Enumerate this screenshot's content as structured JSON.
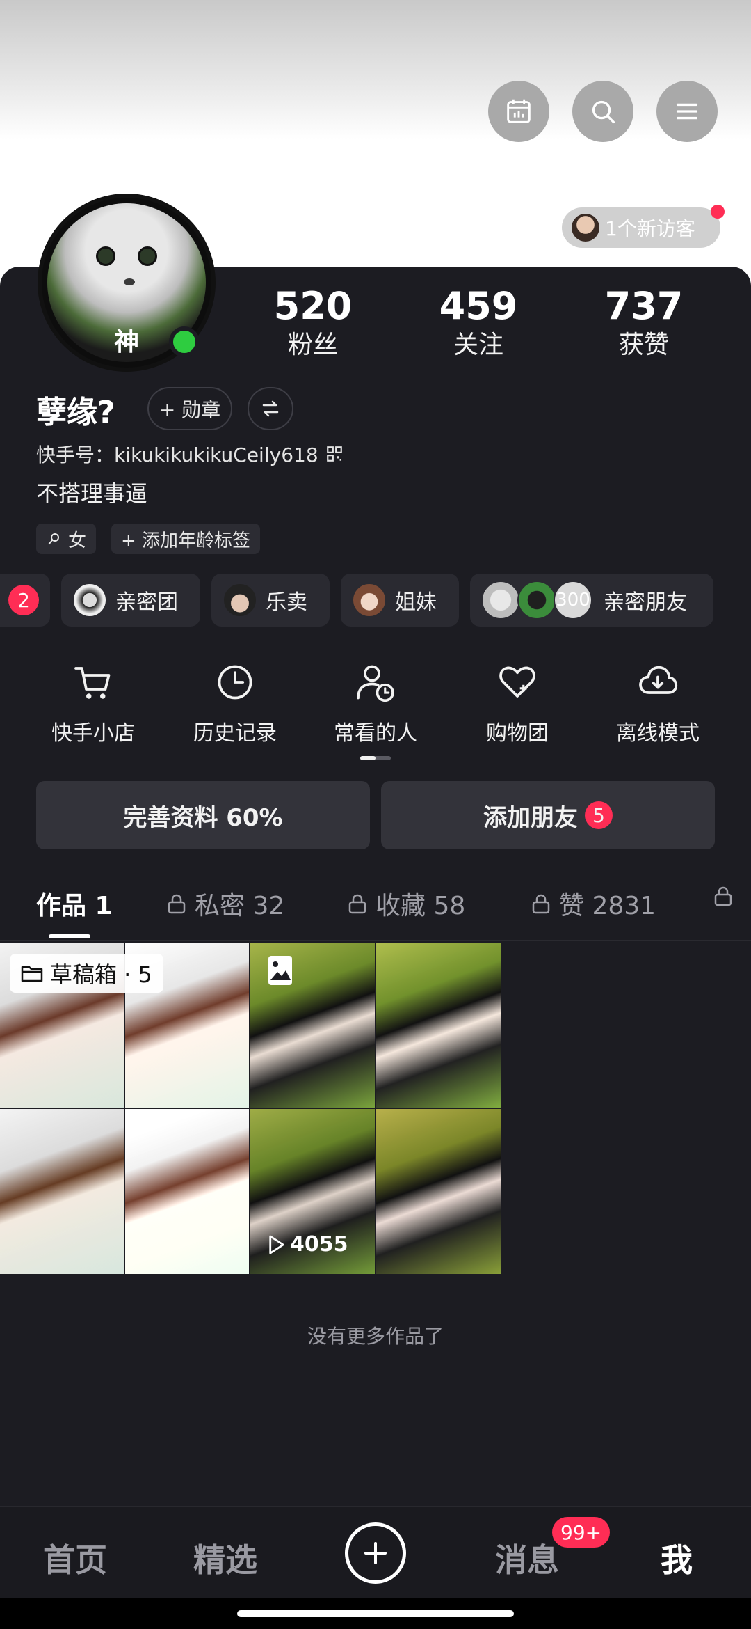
{
  "header": {
    "visitor_text": "1个新访客",
    "icons": [
      "calendar-icon",
      "search-icon",
      "menu-icon"
    ]
  },
  "profile": {
    "avatar_label": "神",
    "username": "孽缘?",
    "medal_button": "+ 勋章",
    "kuaishou_id": "快手号：kikukikukikuCeily618",
    "bio": "不搭理事逼",
    "tags": [
      "女",
      "+ 添加年龄标签"
    ]
  },
  "stats": [
    {
      "value": "520",
      "label": "粉丝"
    },
    {
      "value": "459",
      "label": "关注"
    },
    {
      "value": "737",
      "label": "获赞"
    }
  ],
  "groups": {
    "first_badge": "2",
    "items": [
      {
        "label": "亲密团"
      },
      {
        "label": "乐卖"
      },
      {
        "label": "姐妹"
      },
      {
        "count": "300",
        "label": "亲密朋友"
      }
    ]
  },
  "quick_actions": [
    {
      "label": "快手小店",
      "icon": "cart-icon"
    },
    {
      "label": "历史记录",
      "icon": "clock-icon"
    },
    {
      "label": "常看的人",
      "icon": "person-clock-icon"
    },
    {
      "label": "购物团",
      "icon": "heart-icon"
    },
    {
      "label": "离线模式",
      "icon": "cloud-download-icon"
    }
  ],
  "actions": {
    "complete_profile": "完善资料 60%",
    "add_friends": "添加朋友",
    "add_friends_badge": "5"
  },
  "tabs": [
    {
      "label": "作品 1",
      "active": true
    },
    {
      "label": "私密 32"
    },
    {
      "label": "收藏 58"
    },
    {
      "label": "赞 2831"
    }
  ],
  "grid": {
    "draft_label": "草稿箱 · 5",
    "play_count": "4055"
  },
  "no_more_text": "没有更多作品了",
  "bottom_nav": {
    "home": "首页",
    "featured": "精选",
    "messages": "消息",
    "messages_badge": "99+",
    "me": "我"
  },
  "colors": {
    "background": "#1c1c22",
    "accent_red": "#ff2d55",
    "online_green": "#2ecc40"
  }
}
